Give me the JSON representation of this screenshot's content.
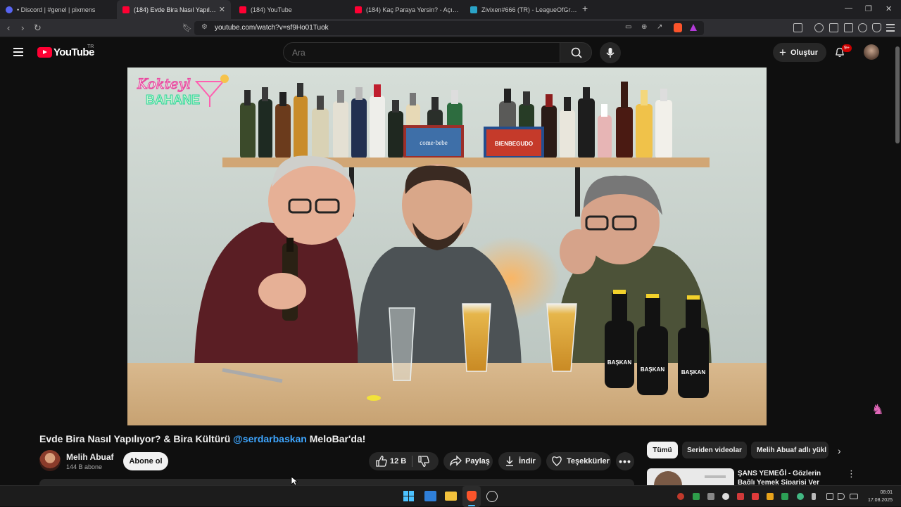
{
  "browser": {
    "tabs": [
      {
        "label": "• Discord | #genel | pixmens",
        "favicon_color": "#5865f2",
        "active": false
      },
      {
        "label": "(184) Evde Bira Nasıl Yapılıyor",
        "favicon_color": "#ff0033",
        "active": true
      },
      {
        "label": "(184) YouTube",
        "favicon_color": "#ff0033",
        "active": false
      },
      {
        "label": "(184) Kaç Paraya Yersin? - Açık Artırm",
        "favicon_color": "#ff0033",
        "active": false
      },
      {
        "label": "Zivixen#666 (TR) - LeagueOfGraphs",
        "favicon_color": "#2aa3c7",
        "active": false
      }
    ],
    "new_tab": "+",
    "url": "youtube.com/watch?v=sf9Ho01Tuok"
  },
  "youtube": {
    "logo_text": "YouTube",
    "country": "TR",
    "search_placeholder": "Ara",
    "create_label": "Oluştur",
    "notifications_badge": "9+"
  },
  "video": {
    "overlay_logo_line1": "Kokteyl",
    "overlay_logo_line2": "BAHANE",
    "box_label_left": "come·bebe",
    "box_label_right": "BIENBEGUDO",
    "bottle_label": "BAŞKAN",
    "title_part1": "Evde Bira Nasıl Yapılıyor? & Bira Kültürü ",
    "title_mention": "@serdarbaskan",
    "title_part2": " MeloBar'da!",
    "channel_name": "Melih Abuaf",
    "subscribers": "144 B abone",
    "subscribe_label": "Abone ol",
    "likes": "12 B",
    "share_label": "Paylaş",
    "download_label": "İndir",
    "thanks_label": "Teşekkürler"
  },
  "sidebar": {
    "chips": [
      "Tümü",
      "Seriden videolar",
      "Melih Abuaf adlı yükl"
    ],
    "selected_chip": "Tümü",
    "recommendation_title": "ŞANS YEMEĞİ - Gözlerin Bağlı Yemek Siparişi Ver"
  },
  "taskbar": {
    "time": "08:01",
    "date": "17.08.2025"
  },
  "colors": {
    "youtube_red": "#ff0033",
    "mention_blue": "#3ea6ff",
    "background": "#0f0f0f"
  }
}
